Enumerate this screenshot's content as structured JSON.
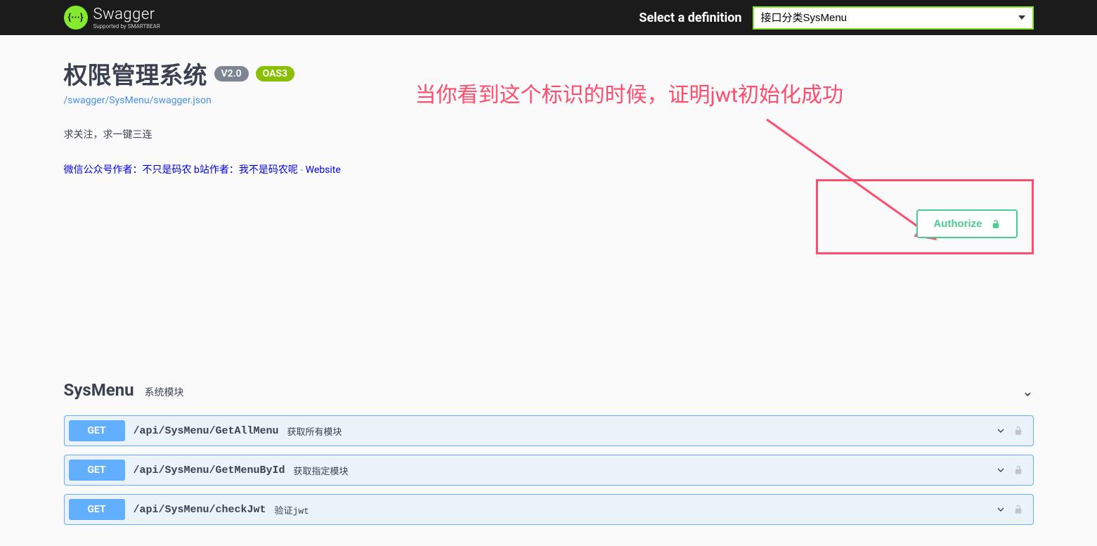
{
  "topbar": {
    "logo_main": "Swagger",
    "logo_sub": "Supported by SMARTBEAR",
    "logo_glyph": "{···}",
    "select_label": "Select a definition",
    "select_value": "接口分类SysMenu"
  },
  "info": {
    "title": "权限管理系统",
    "version": "V2.0",
    "oas": "OAS3",
    "spec_url": "/swagger/SysMenu/swagger.json",
    "description": "求关注，求一键三连",
    "contact_wechat": "微信公众号作者：不只是码农",
    "contact_bili": "b站作者：我不是码农呢",
    "website_label": "Website"
  },
  "annotation": "当你看到这个标识的时候，证明jwt初始化成功",
  "authorize_label": "Authorize",
  "tag": {
    "name": "SysMenu",
    "description": "系统模块"
  },
  "operations": [
    {
      "method": "GET",
      "path": "/api/SysMenu/GetAllMenu",
      "summary": "获取所有模块"
    },
    {
      "method": "GET",
      "path": "/api/SysMenu/GetMenuById",
      "summary": "获取指定模块"
    },
    {
      "method": "GET",
      "path": "/api/SysMenu/checkJwt",
      "summary": "验证jwt"
    }
  ]
}
